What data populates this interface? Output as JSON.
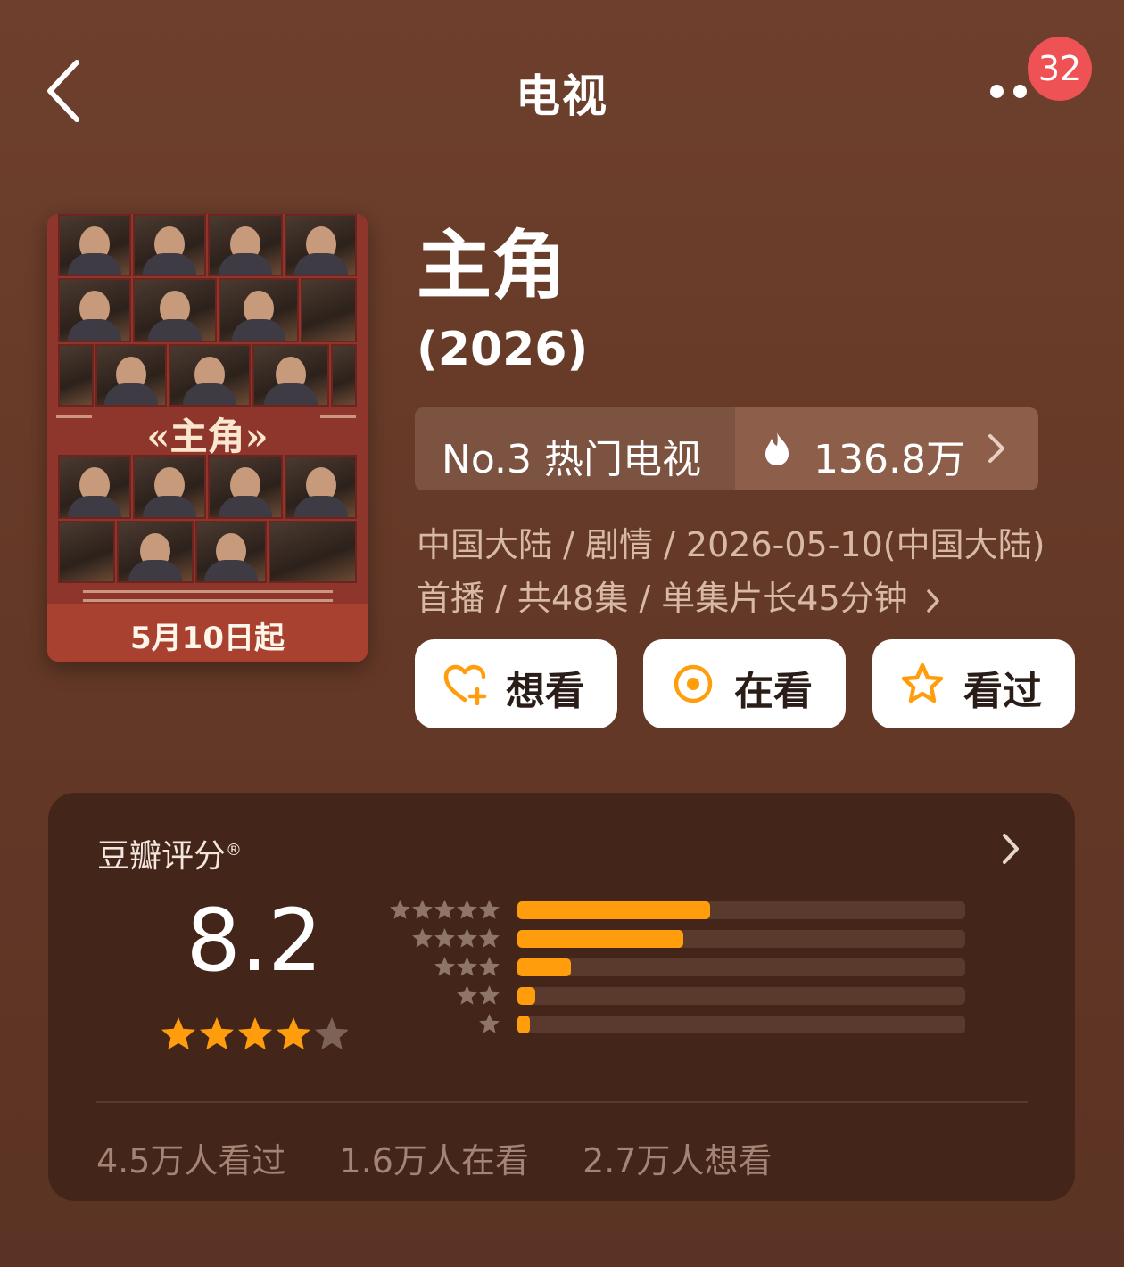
{
  "header": {
    "title": "电视",
    "notification_count": "32"
  },
  "poster": {
    "title": "«主角»",
    "date": "5月10日起"
  },
  "show": {
    "title": "主角",
    "year": "(2026)",
    "rank_label": "No.3 热门电视",
    "hot_value": "136.8万",
    "meta_line1": "中国大陆 / 剧情 / 2026-05-10(中国大陆)",
    "meta_line2": "首播 / 共48集 / 单集片长45分钟"
  },
  "actions": {
    "want_label": "想看",
    "watching_label": "在看",
    "watched_label": "看过"
  },
  "rating": {
    "title": "豆瓣评分",
    "registered_mark": "®",
    "score": "8.2",
    "score_stars": 4,
    "distribution": [
      {
        "stars": 5,
        "fraction": 0.43
      },
      {
        "stars": 4,
        "fraction": 0.37
      },
      {
        "stars": 3,
        "fraction": 0.12
      },
      {
        "stars": 2,
        "fraction": 0.04
      },
      {
        "stars": 1,
        "fraction": 0.02
      }
    ],
    "stats": {
      "watched": "4.5万人看过",
      "watching": "1.6万人在看",
      "want": "2.7万人想看"
    }
  },
  "colors": {
    "accent_orange": "#ff9d0d",
    "badge_red": "#ee5255"
  }
}
